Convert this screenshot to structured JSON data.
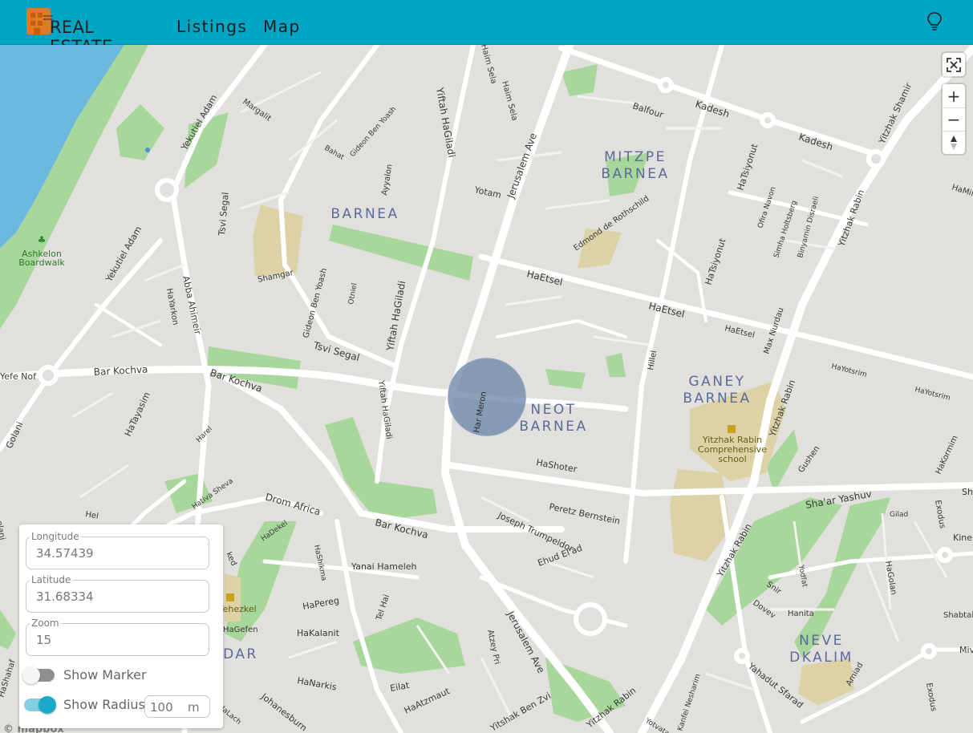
{
  "header": {
    "logo_text": "REAL ESTATE",
    "nav": {
      "listings": "Listings",
      "map": "Map"
    }
  },
  "map": {
    "streets": {
      "kadesh_1": "Kadesh",
      "kadesh_2": "Kadesh",
      "balfour": "Balfour",
      "yitzhak_shamir": "Yitzhak Shamir",
      "hamil": "HaMil",
      "haetsel_1": "HaEtsel",
      "haetsel_2": "HaEtsel",
      "haetsel_3": "HaEtsel",
      "hayotsrim_1": "HaYotsrim",
      "hayotsrim_2": "HaYotsrim",
      "jerusalem_ave_1": "Jerusalem Ave",
      "jerusalem_ave_2": "Jerusalem Ave",
      "yotam": "Yotam",
      "yiftah_hagiladi_1": "Yiftah HaGiladi",
      "yiftah_hagiladi_2": "Yiftah HaGiladi",
      "yiftah_hagiladi_3": "Yiftah HaGiladi",
      "haim_sela_1": "Haim Sela",
      "haim_sela_2": "Haim Sela",
      "edmond": "Edmond de Rothschild",
      "hatsiyonut_1": "HaTsiyonut",
      "hatsiyonut_2": "HaTsiyonut",
      "ofira_navon": "Ofira Navon",
      "simha_holtsberg": "Simha Holtsberg",
      "binyamin_disraeli": "Binyamin Disraeli",
      "yitzhak_rabin_1": "Yitzhak Rabin",
      "yitzhak_rabin_2": "Yitzhak Rabin",
      "yitzhak_rabin_3": "Yitzhak Rabin",
      "yitzhak_rabin_4": "Yitzhak Rabin",
      "yekutiel_adam_1": "Yekutiel Adam",
      "yekutiel_adam_2": "Yekutiel Adam",
      "margalit": "Margalit",
      "bahat": "Bahat",
      "gideon_ben_yoash_1": "Gideon Ben Yoash",
      "gideon_ben_yoash_2": "Gideon Ben Yoash",
      "ayyalon": "Ayyalon",
      "tsvi_segal_1": "Tsvi Segal",
      "tsvi_segal_2": "Tsvi Segal",
      "shamgar": "Shamgar",
      "otniel": "Otniel",
      "abba_ahimeir": "Abba Ahimeir",
      "hayarkon": "HaYarkon",
      "bar_kochva_1": "Bar Kochva",
      "bar_kochva_2": "Bar Kochva",
      "bar_kochva_3": "Bar Kochva",
      "yefe_nof": "Yefe Nof",
      "golani_1": "Golani",
      "golani_2": "Golani",
      "hatayasim": "HaTayasim",
      "harel": "Harel",
      "hativa_sheva": "Hativa Sheva",
      "drom_africa": "Drom Africa",
      "hadekel": "HaDekel",
      "hashikma": "HaShikma",
      "yanai_hameleh": "Yanai Hameleh",
      "hapereg": "HaPereg",
      "tel_hai": "Tel Hai",
      "hagefen": "HaGefen",
      "hakalanit": "HaKalanit",
      "hanarkis": "HaNarkis",
      "eilat": "Eilat",
      "haatsmaut": "HaAtzmaut",
      "johanesburg": "Johanesburn",
      "har_meron": "Har Meron",
      "hashoter": "HaShoter",
      "peretz_bernstein": "Peretz Bernstein",
      "joseph_trumpeldor": "Joseph Trumpeldor",
      "ehud_elad": "Ehud El'ad",
      "atzey_pri": "Atzey Pri",
      "yitshak_ben_zvi": "Yitshak Ben Zvi",
      "hillel": "Hillel",
      "max_nordau": "Max Nurdau",
      "gushen": "Gushen",
      "hakormim": "HaKormim",
      "shaar_yashuv": "Sha'ar Yashuv",
      "gilad": "Gilad",
      "exodus_1": "Exodus",
      "exodus_2": "Exodus",
      "kinneret": "Kiner",
      "yodfat": "Yodfat",
      "hagolan": "HaGolan",
      "shabtai": "Shabtai",
      "snir": "Snir",
      "dovev": "Dovev",
      "hanita": "Hanita",
      "amiad": "Amiad",
      "yahadut_sfarad": "Yahadut Sfarad",
      "kanfei_nesharim": "Kanfei Nesharim",
      "yotvata": "Yotvata",
      "mivtsa": "Miv",
      "sh": "Sh",
      "yehezkel": "Yehezkel",
      "hashahaf": "HaShahaf",
      "halach": "HaLach",
      "hel": "Hel",
      "olani": "olani",
      "ked": "ked"
    },
    "areas": {
      "barnea": "BARNEA",
      "mitzpe_1": "MITZPE",
      "mitzpe_2": "BARNEA",
      "neot_1": "NEOT",
      "neot_2": "BARNEA",
      "ganey_1": "GANEY",
      "ganey_2": "BARNEA",
      "neve_1": "NEVE",
      "neve_2": "DKALIM",
      "dar": "DAR"
    },
    "poi": {
      "boardwalk_1": "Ashkelon",
      "boardwalk_2": "Boardwalk",
      "school_1": "Yitzhak Rabin",
      "school_2": "Comprehensive",
      "school_3": "school"
    },
    "attribution": "© mapbox"
  },
  "controls": {
    "fullscreen": "fullscreen-icon",
    "zoom_in": "+",
    "zoom_out": "−"
  },
  "panel": {
    "longitude": {
      "label": "Longitude",
      "value": "34.57439"
    },
    "latitude": {
      "label": "Latitude",
      "value": "31.68334"
    },
    "zoom": {
      "label": "Zoom",
      "value": "15"
    },
    "show_marker": {
      "label": "Show Marker",
      "checked": false
    },
    "show_radius": {
      "label": "Show Radius",
      "checked": true,
      "value": "100",
      "unit": "m"
    }
  },
  "colors": {
    "header": "#00a6c4",
    "accent": "#4fb5d0",
    "radius_circle": "#6b86a8",
    "water": "#6cb9e0",
    "park": "#a7d79a",
    "school": "#dcd2a6"
  }
}
